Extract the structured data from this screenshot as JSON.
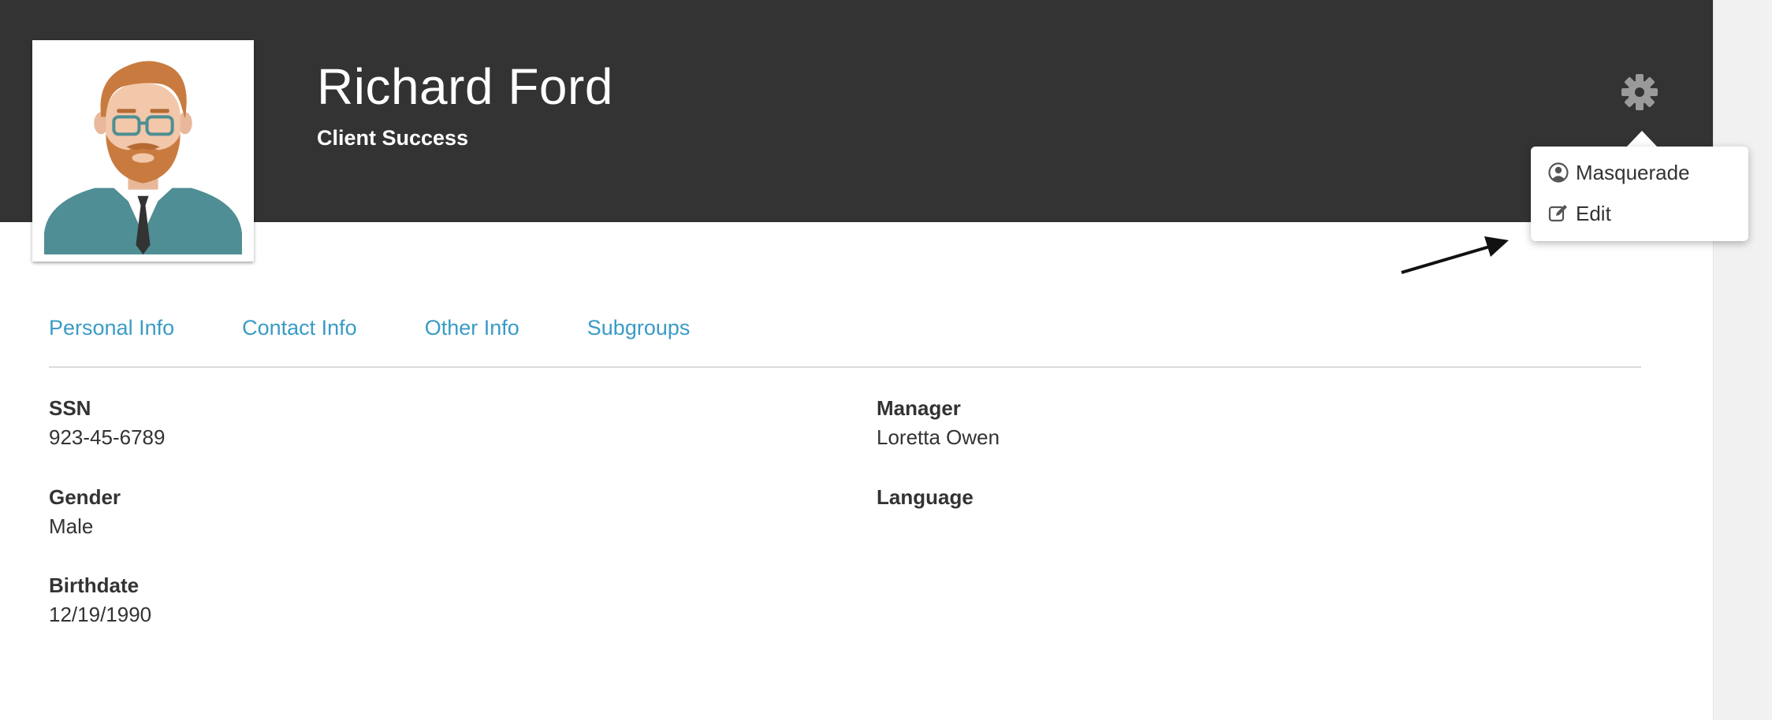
{
  "profile": {
    "name": "Richard Ford",
    "role": "Client Success"
  },
  "menu": {
    "items": [
      {
        "label": "Masquerade",
        "icon": "user-circle-icon"
      },
      {
        "label": "Edit",
        "icon": "edit-icon"
      }
    ]
  },
  "tabs": [
    {
      "label": "Personal Info"
    },
    {
      "label": "Contact Info"
    },
    {
      "label": "Other Info"
    },
    {
      "label": "Subgroups"
    }
  ],
  "fields": {
    "ssn": {
      "label": "SSN",
      "value": "923-45-6789"
    },
    "gender": {
      "label": "Gender",
      "value": "Male"
    },
    "birthdate": {
      "label": "Birthdate",
      "value": "12/19/1990"
    },
    "manager": {
      "label": "Manager",
      "value": "Loretta Owen"
    },
    "language": {
      "label": "Language",
      "value": ""
    }
  },
  "colors": {
    "header_bg": "#333333",
    "tab_link": "#3a9bc6",
    "text": "#333333"
  }
}
